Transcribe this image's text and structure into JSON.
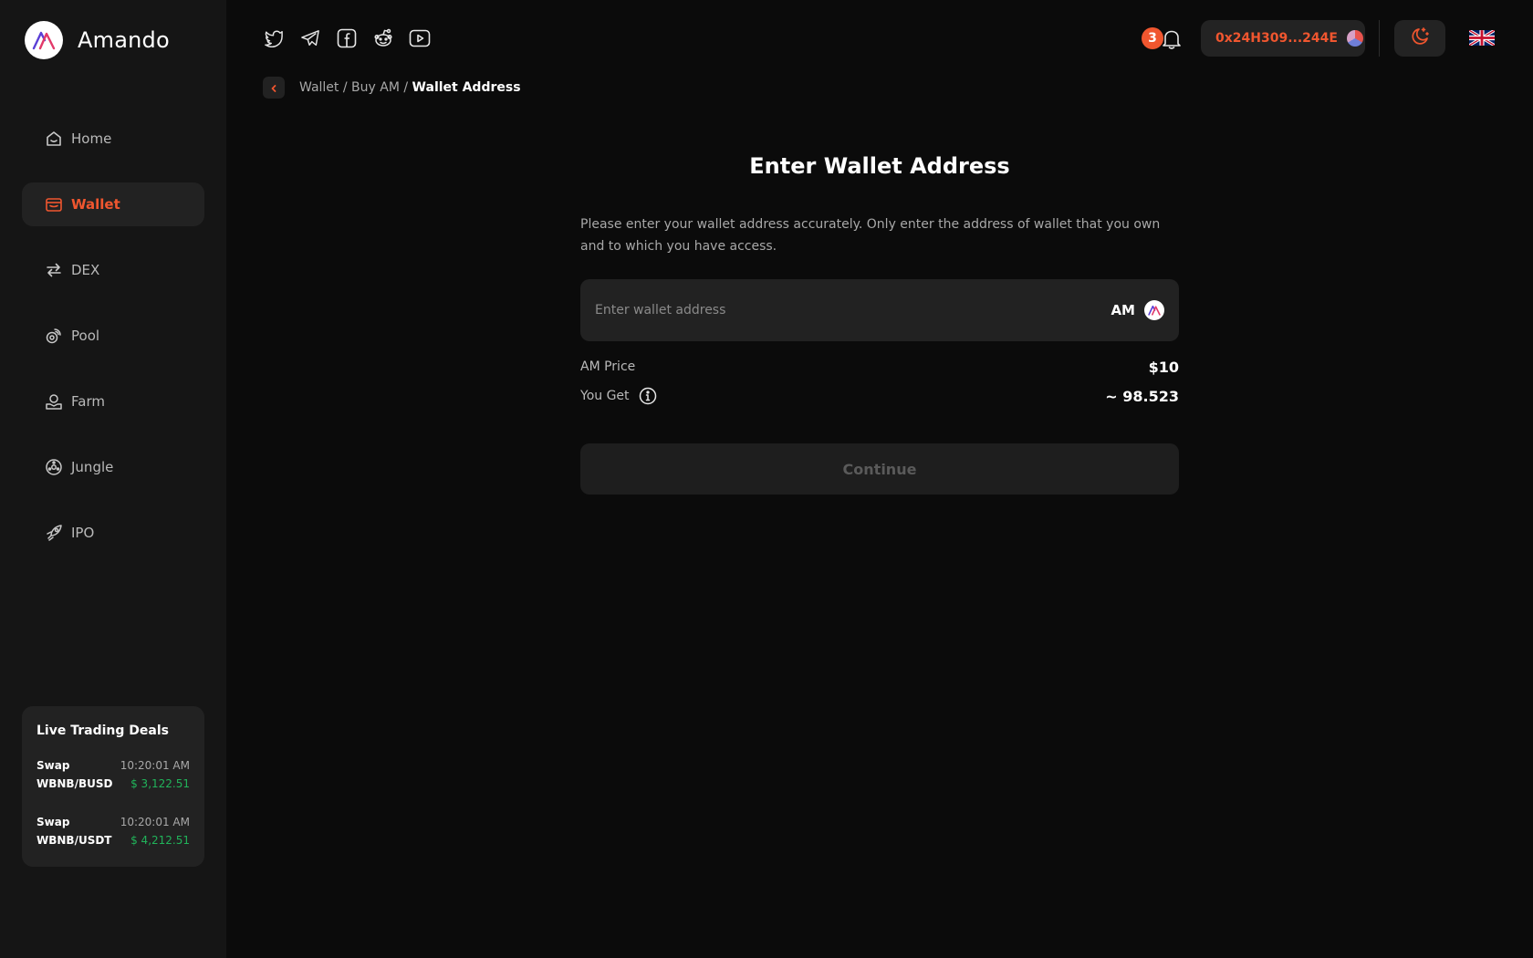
{
  "brand": {
    "name": "Amando"
  },
  "sidebar": {
    "items": [
      {
        "label": "Home",
        "icon": "home-icon",
        "active": false
      },
      {
        "label": "Wallet",
        "icon": "wallet-icon",
        "active": true
      },
      {
        "label": "DEX",
        "icon": "swap-arrows-icon",
        "active": false
      },
      {
        "label": "Pool",
        "icon": "pool-icon",
        "active": false
      },
      {
        "label": "Farm",
        "icon": "farm-icon",
        "active": false
      },
      {
        "label": "Jungle",
        "icon": "jungle-icon",
        "active": false
      },
      {
        "label": "IPO",
        "icon": "rocket-icon",
        "active": false
      }
    ]
  },
  "live_deals": {
    "title": "Live Trading Deals",
    "deals": [
      {
        "type": "Swap",
        "time": "10:20:01 AM",
        "pair": "WBNB/BUSD",
        "amount": "$ 3,122.51"
      },
      {
        "type": "Swap",
        "time": "10:20:01 AM",
        "pair": "WBNB/USDT",
        "amount": "$ 4,212.51"
      }
    ]
  },
  "header": {
    "socials": [
      "twitter-icon",
      "telegram-icon",
      "facebook-icon",
      "reddit-icon",
      "youtube-icon"
    ],
    "notification_count": "3",
    "wallet_address": "0x24H309...244E",
    "language_flag": "uk-flag"
  },
  "breadcrumb": {
    "items": [
      "Wallet",
      "Buy AM"
    ],
    "separator": " / ",
    "current": "Wallet Address"
  },
  "main": {
    "title": "Enter Wallet Address",
    "description": "Please enter your wallet address accurately. Only enter the address of wallet that you own and to which you have access.",
    "input_placeholder": "Enter wallet address",
    "input_value": "",
    "token_label": "AM",
    "price_label": "AM Price",
    "price_value": "$10",
    "get_label": "You Get",
    "get_value": "~ 98.523",
    "continue_label": "Continue"
  },
  "colors": {
    "accent": "#f0562f",
    "positive": "#21b35a",
    "background": "#0b0b0b",
    "sidebar": "#151515",
    "panel": "#222222"
  }
}
